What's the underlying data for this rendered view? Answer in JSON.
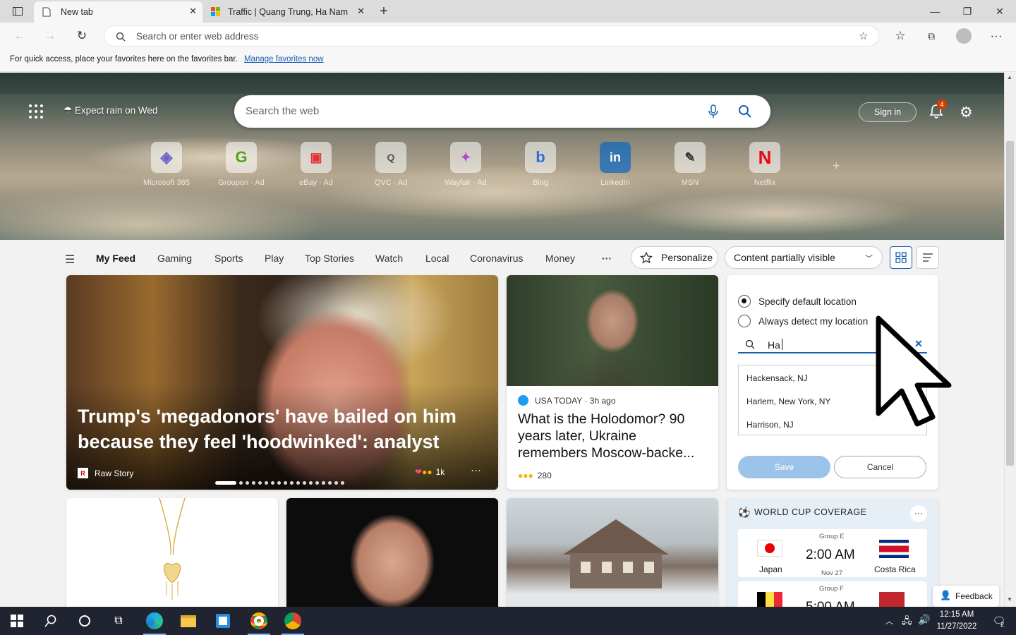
{
  "browser": {
    "tabs": [
      {
        "title": "New tab"
      },
      {
        "title": "Traffic | Quang Trung, Ha Nam"
      }
    ],
    "address_placeholder": "Search or enter web address",
    "favorites_bar": {
      "message": "For quick access, place your favorites here on the favorites bar.",
      "link": "Manage favorites now"
    }
  },
  "hero": {
    "weather": "Expect rain on Wed",
    "search_placeholder": "Search the web",
    "sign_in": "Sign in",
    "notifications_count": "4",
    "tiles": [
      {
        "label": "Microsoft 365",
        "icon": "microsoft-365-icon"
      },
      {
        "label": "Groupon · Ad",
        "icon": "groupon-icon"
      },
      {
        "label": "eBay · Ad",
        "icon": "ebay-icon"
      },
      {
        "label": "QVC · Ad",
        "icon": "qvc-icon"
      },
      {
        "label": "Wayfair · Ad",
        "icon": "wayfair-icon"
      },
      {
        "label": "Bing",
        "icon": "bing-icon"
      },
      {
        "label": "LinkedIn",
        "icon": "linkedin-icon"
      },
      {
        "label": "MSN",
        "icon": "msn-icon"
      },
      {
        "label": "Netflix",
        "icon": "netflix-icon"
      }
    ]
  },
  "feed_nav": {
    "items": [
      "My Feed",
      "Gaming",
      "Sports",
      "Play",
      "Top Stories",
      "Watch",
      "Local",
      "Coronavirus",
      "Money"
    ],
    "more": "···",
    "personalize": "Personalize",
    "content_select": "Content partially visible"
  },
  "cards": {
    "main": {
      "title": "Trump's 'megadonors' have bailed on him because they feel 'hoodwinked': analyst",
      "source": "Raw Story",
      "reactions": "1k"
    },
    "second": {
      "source": "USA TODAY · 3h ago",
      "title": "What is the Holodomor? 90 years later, Ukraine remembers Moscow-backe...",
      "reactions": "280"
    }
  },
  "location_panel": {
    "option_default": "Specify default location",
    "option_detect": "Always detect my location",
    "input_value": "Ha",
    "suggestions": [
      "Hackensack, NJ",
      "Harlem, New York, NY",
      "Harrison, NJ"
    ],
    "save": "Save",
    "cancel": "Cancel"
  },
  "world_cup": {
    "title": "WORLD CUP COVERAGE",
    "match1": {
      "group": "Group E",
      "time": "2:00 AM",
      "date": "Nov 27",
      "team1": "Japan",
      "team2": "Costa Rica"
    },
    "match2": {
      "group": "Group F",
      "time": "5:00 AM"
    }
  },
  "feedback": "Feedback",
  "taskbar": {
    "time": "12:15 AM",
    "date": "11/27/2022",
    "notification_count": "2"
  }
}
